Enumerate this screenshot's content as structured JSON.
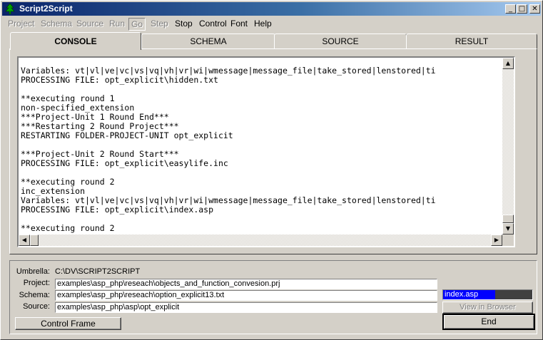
{
  "window": {
    "title": "Script2Script",
    "minimize_glyph": "_",
    "maximize_glyph": "□",
    "close_glyph": "✕"
  },
  "menu": {
    "items": [
      {
        "label": "Project",
        "enabled": false
      },
      {
        "label": "Schema",
        "enabled": false
      },
      {
        "label": "Source",
        "enabled": false
      },
      {
        "label": "Run",
        "enabled": false
      },
      {
        "label": "Go",
        "enabled": false,
        "pressed": true
      },
      {
        "label": "Step",
        "enabled": false
      },
      {
        "label": "Stop",
        "enabled": true
      },
      {
        "label": "Control",
        "enabled": true
      },
      {
        "label": "Font",
        "enabled": true
      },
      {
        "label": "Help",
        "enabled": true
      }
    ]
  },
  "tabs": [
    {
      "label": "CONSOLE",
      "active": true
    },
    {
      "label": "SCHEMA",
      "active": false
    },
    {
      "label": "SOURCE",
      "active": false
    },
    {
      "label": "RESULT",
      "active": false
    }
  ],
  "console": {
    "lines": [
      "Variables: vt|vl|ve|vc|vs|vq|vh|vr|wi|wmessage|message_file|take_stored|lenstored|ti",
      "PROCESSING FILE: opt_explicit\\hidden.txt",
      "",
      "**executing round 1",
      "non-specified_extension",
      "***Project-Unit 1 Round End***",
      "***Restarting 2 Round Project***",
      "RESTARTING FOLDER-PROJECT-UNIT opt_explicit",
      "",
      "***Project-Unit 2 Round Start***",
      "PROCESSING FILE: opt_explicit\\easylife.inc",
      "",
      "**executing round 2",
      "inc_extension",
      "Variables: vt|vl|ve|vc|vs|vq|vh|vr|wi|wmessage|message_file|take_stored|lenstored|ti",
      "PROCESSING FILE: opt_explicit\\index.asp",
      "",
      "**executing round 2"
    ],
    "vscroll_position": 0.92,
    "hscroll_position": 0.0
  },
  "info": {
    "umbrella_label": "Umbrella:",
    "umbrella_value": "C:\\DV\\SCRIPT2SCRIPT",
    "project_label": "Project:",
    "project_value": "examples\\asp_php\\reseach\\objects_and_function_convesion.prj",
    "schema_label": "Schema:",
    "schema_value": "examples\\asp_php\\reseach\\option_explicit13.txt",
    "source_label": "Source:",
    "source_value": "examples\\asp_php\\asp\\opt_explicit"
  },
  "progress": {
    "text": "index.asp",
    "fraction": 0.58
  },
  "buttons": {
    "control_frame": "Control Frame",
    "view_in_browser": "View in Browser",
    "end": "End"
  },
  "icons": {
    "app": "tree-icon",
    "scroll_up": "▲",
    "scroll_down": "▼",
    "scroll_left": "◀",
    "scroll_right": "▶"
  }
}
